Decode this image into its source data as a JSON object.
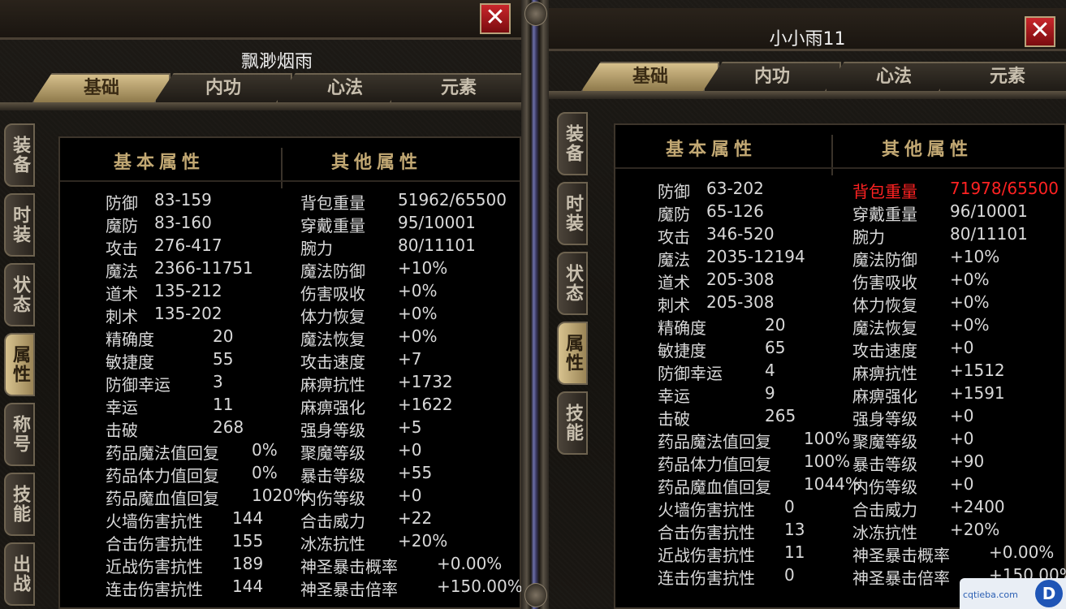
{
  "left": {
    "name": "飘渺烟雨",
    "tabs": [
      "基础",
      "内功",
      "心法",
      "元素"
    ],
    "active_tab": 0,
    "side_tabs": [
      "装备",
      "时装",
      "状态",
      "属性",
      "称号",
      "技能",
      "出战"
    ],
    "active_side": 3,
    "header_basic": "基本属性",
    "header_other": "其他属性",
    "basic": [
      {
        "label": "防御",
        "value": "83-159"
      },
      {
        "label": "魔防",
        "value": "83-160"
      },
      {
        "label": "攻击",
        "value": "276-417"
      },
      {
        "label": "魔法",
        "value": "2366-11751"
      },
      {
        "label": "道术",
        "value": "135-212"
      },
      {
        "label": "刺术",
        "value": "135-202"
      },
      {
        "label": "精确度",
        "value": "20"
      },
      {
        "label": "敏捷度",
        "value": "55"
      },
      {
        "label": "防御幸运",
        "value": "3"
      },
      {
        "label": "幸运",
        "value": "11"
      },
      {
        "label": "击破",
        "value": "268"
      },
      {
        "label": "药品魔法值回复",
        "value": "0%"
      },
      {
        "label": "药品体力值回复",
        "value": "0%"
      },
      {
        "label": "药品魔血值回复",
        "value": "1020%"
      },
      {
        "label": "火墙伤害抗性",
        "value": "144"
      },
      {
        "label": "合击伤害抗性",
        "value": "155"
      },
      {
        "label": "近战伤害抗性",
        "value": "189"
      },
      {
        "label": "连击伤害抗性",
        "value": "144"
      }
    ],
    "other": [
      {
        "label": "背包重量",
        "value": "51962/65500"
      },
      {
        "label": "穿戴重量",
        "value": "95/10001"
      },
      {
        "label": "腕力",
        "value": "80/11101"
      },
      {
        "label": "魔法防御",
        "value": "+10%"
      },
      {
        "label": "伤害吸收",
        "value": "+0%"
      },
      {
        "label": "体力恢复",
        "value": "+0%"
      },
      {
        "label": "魔法恢复",
        "value": "+0%"
      },
      {
        "label": "攻击速度",
        "value": "+7"
      },
      {
        "label": "麻痹抗性",
        "value": "+1732"
      },
      {
        "label": "麻痹强化",
        "value": "+1622"
      },
      {
        "label": "强身等级",
        "value": "+5"
      },
      {
        "label": "聚魔等级",
        "value": "+0"
      },
      {
        "label": "暴击等级",
        "value": "+55"
      },
      {
        "label": "内伤等级",
        "value": "+0"
      },
      {
        "label": "合击威力",
        "value": "+22"
      },
      {
        "label": "冰冻抗性",
        "value": "+20%"
      },
      {
        "label": "神圣暴击概率",
        "value": "+0.00%"
      },
      {
        "label": "神圣暴击倍率",
        "value": "+150.00%"
      }
    ]
  },
  "right": {
    "name": "小小雨11",
    "tabs": [
      "基础",
      "内功",
      "心法",
      "元素"
    ],
    "active_tab": 0,
    "side_tabs": [
      "装备",
      "时装",
      "状态",
      "属性",
      "技能"
    ],
    "active_side": 3,
    "header_basic": "基本属性",
    "header_other": "其他属性",
    "basic": [
      {
        "label": "防御",
        "value": "63-202"
      },
      {
        "label": "魔防",
        "value": "65-126"
      },
      {
        "label": "攻击",
        "value": "346-520"
      },
      {
        "label": "魔法",
        "value": "2035-12194"
      },
      {
        "label": "道术",
        "value": "205-308"
      },
      {
        "label": "刺术",
        "value": "205-308"
      },
      {
        "label": "精确度",
        "value": "20"
      },
      {
        "label": "敏捷度",
        "value": "65"
      },
      {
        "label": "防御幸运",
        "value": "4"
      },
      {
        "label": "幸运",
        "value": "9"
      },
      {
        "label": "击破",
        "value": "265"
      },
      {
        "label": "药品魔法值回复",
        "value": "100%"
      },
      {
        "label": "药品体力值回复",
        "value": "100%"
      },
      {
        "label": "药品魔血值回复",
        "value": "1044%"
      },
      {
        "label": "火墙伤害抗性",
        "value": "0"
      },
      {
        "label": "合击伤害抗性",
        "value": "13"
      },
      {
        "label": "近战伤害抗性",
        "value": "11"
      },
      {
        "label": "连击伤害抗性",
        "value": "0"
      }
    ],
    "other": [
      {
        "label": "背包重量",
        "value": "71978/65500",
        "warn": true
      },
      {
        "label": "穿戴重量",
        "value": "96/10001"
      },
      {
        "label": "腕力",
        "value": "80/11101"
      },
      {
        "label": "魔法防御",
        "value": "+10%"
      },
      {
        "label": "伤害吸收",
        "value": "+0%"
      },
      {
        "label": "体力恢复",
        "value": "+0%"
      },
      {
        "label": "魔法恢复",
        "value": "+0%"
      },
      {
        "label": "攻击速度",
        "value": "+0"
      },
      {
        "label": "麻痹抗性",
        "value": "+1512"
      },
      {
        "label": "麻痹强化",
        "value": "+1591"
      },
      {
        "label": "强身等级",
        "value": "+0"
      },
      {
        "label": "聚魔等级",
        "value": "+0"
      },
      {
        "label": "暴击等级",
        "value": "+90"
      },
      {
        "label": "内伤等级",
        "value": "+0"
      },
      {
        "label": "合击威力",
        "value": "+2400"
      },
      {
        "label": "冰冻抗性",
        "value": "+20%"
      },
      {
        "label": "神圣暴击概率",
        "value": "+0.00%"
      },
      {
        "label": "神圣暴击倍率",
        "value": "+150.00%"
      }
    ]
  },
  "close_glyph": "✕",
  "colors": {
    "warn": "#ff2222",
    "text": "#d9d9d9",
    "header": "#c2a873"
  },
  "watermark": {
    "text": "cqtieba.com",
    "logo": "D"
  }
}
